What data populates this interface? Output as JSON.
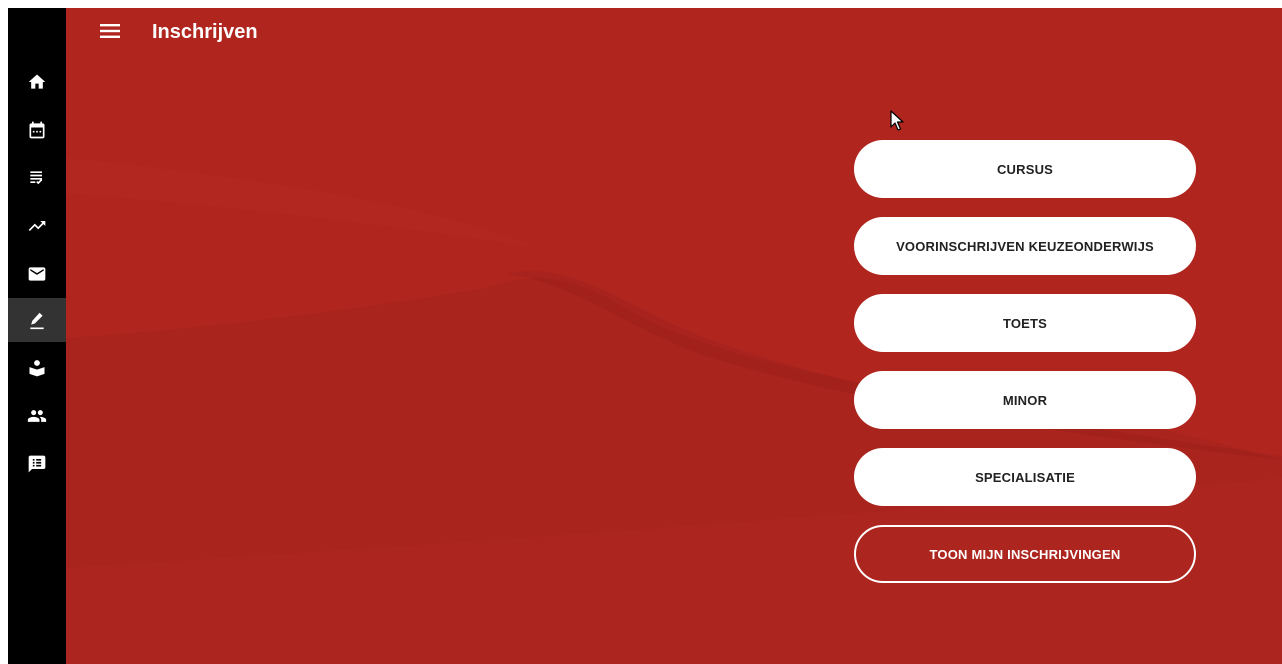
{
  "header": {
    "title": "Inschrijven",
    "menu_icon": "menu-icon"
  },
  "sidebar": {
    "items": [
      {
        "name": "home",
        "icon": "home-icon"
      },
      {
        "name": "calendar",
        "icon": "calendar-icon"
      },
      {
        "name": "list",
        "icon": "list-check-icon"
      },
      {
        "name": "progress",
        "icon": "trending-up-icon"
      },
      {
        "name": "mail",
        "icon": "mail-icon"
      },
      {
        "name": "enroll",
        "icon": "pencil-icon",
        "active": true
      },
      {
        "name": "student",
        "icon": "student-icon"
      },
      {
        "name": "people",
        "icon": "people-icon"
      },
      {
        "name": "feedback",
        "icon": "chat-icon"
      }
    ]
  },
  "options": {
    "cursus": "CURSUS",
    "voorinschrijven": "VOORINSCHRIJVEN KEUZEONDERWIJS",
    "toets": "TOETS",
    "minor": "MINOR",
    "specialisatie": "SPECIALISATIE",
    "toon": "TOON MIJN INSCHRIJVINGEN"
  },
  "colors": {
    "background": "#b0261f",
    "sidebar": "#000000",
    "sidebar_active": "#333333",
    "button": "#ffffff"
  }
}
